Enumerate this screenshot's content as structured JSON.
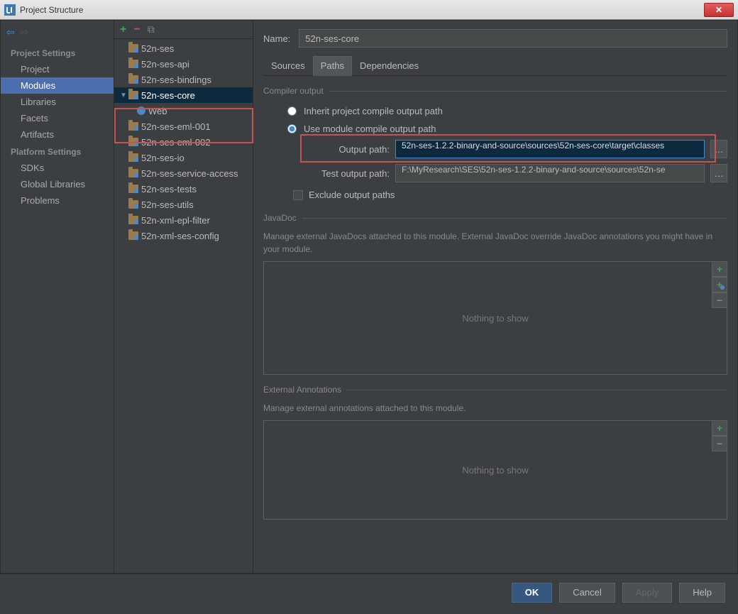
{
  "window": {
    "title": "Project Structure"
  },
  "sidebar": {
    "sections": [
      {
        "header": "Project Settings",
        "items": [
          "Project",
          "Modules",
          "Libraries",
          "Facets",
          "Artifacts"
        ],
        "selected": 1
      },
      {
        "header": "Platform Settings",
        "items": [
          "SDKs",
          "Global Libraries"
        ]
      },
      {
        "header": "",
        "items": [
          "Problems"
        ]
      }
    ]
  },
  "tree": {
    "items": [
      {
        "label": "52n-ses"
      },
      {
        "label": "52n-ses-api"
      },
      {
        "label": "52n-ses-bindings"
      },
      {
        "label": "52n-ses-core",
        "expanded": true,
        "selected": true,
        "children": [
          {
            "label": "Web",
            "web": true
          }
        ]
      },
      {
        "label": "52n-ses-eml-001"
      },
      {
        "label": "52n-ses-eml-002"
      },
      {
        "label": "52n-ses-io"
      },
      {
        "label": "52n-ses-service-access"
      },
      {
        "label": "52n-ses-tests"
      },
      {
        "label": "52n-ses-utils"
      },
      {
        "label": "52n-xml-epl-filter"
      },
      {
        "label": "52n-xml-ses-config"
      }
    ]
  },
  "main": {
    "name_label": "Name:",
    "name_value": "52n-ses-core",
    "tabs": [
      "Sources",
      "Paths",
      "Dependencies"
    ],
    "active_tab": 1,
    "compiler": {
      "legend": "Compiler output",
      "inherit_label": "Inherit project compile output path",
      "use_module_label": "Use module compile output path",
      "output_label": "Output path:",
      "output_value": "52n-ses-1.2.2-binary-and-source\\sources\\52n-ses-core\\target\\classes",
      "test_output_label": "Test output path:",
      "test_output_value": "F:\\MyResearch\\SES\\52n-ses-1.2.2-binary-and-source\\sources\\52n-se",
      "exclude_label": "Exclude output paths"
    },
    "javadoc": {
      "legend": "JavaDoc",
      "desc": "Manage external JavaDocs attached to this module. External JavaDoc override JavaDoc annotations you might have in your module.",
      "empty": "Nothing to show"
    },
    "annotations": {
      "legend": "External Annotations",
      "desc": "Manage external annotations attached to this module.",
      "empty": "Nothing to show"
    }
  },
  "footer": {
    "ok": "OK",
    "cancel": "Cancel",
    "apply": "Apply",
    "help": "Help"
  }
}
